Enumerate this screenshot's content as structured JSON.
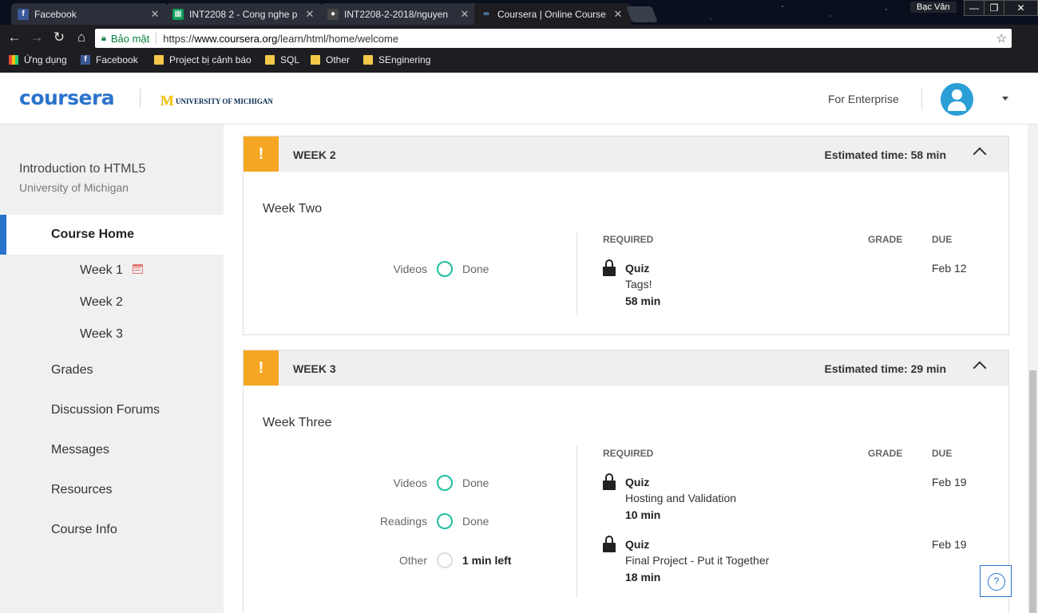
{
  "browser": {
    "tabs": [
      {
        "label": "Facebook",
        "icon": "facebook-icon",
        "color": "#3b5998",
        "glyph": "f"
      },
      {
        "label": "INT2208 2 - Cong nghe p",
        "icon": "sheets-icon",
        "color": "#0f9d58",
        "glyph": "▦"
      },
      {
        "label": "INT2208-2-2018/nguyen",
        "icon": "github-icon",
        "color": "#444444",
        "glyph": "●"
      },
      {
        "label": "Coursera | Online Course",
        "icon": "coursera-icon",
        "color": "#2a73cc",
        "glyph": "∞"
      }
    ],
    "user": "Bạc Vân",
    "secure_label": "Bảo mật",
    "url_scheme": "https://",
    "url_host": "www.coursera.org",
    "url_path": "/learn/html/home/welcome",
    "bookmarks": [
      "Ứng dụng",
      "Facebook",
      "Project bị cảnh báo",
      "SQL",
      "Other",
      "SEnginering"
    ]
  },
  "header": {
    "logo": "coursera",
    "partner": "UNIVERSITY OF MICHIGAN",
    "partner_mark": "M",
    "enterprise": "For Enterprise"
  },
  "sidebar": {
    "course_title": "Introduction to HTML5",
    "course_uni": "University of Michigan",
    "home": "Course Home",
    "weeks": [
      "Week 1",
      "Week 2",
      "Week 3"
    ],
    "items": [
      "Grades",
      "Discussion Forums",
      "Messages",
      "Resources",
      "Course Info"
    ]
  },
  "weeks": [
    {
      "label": "WEEK 2",
      "estimated": "Estimated time: 58 min",
      "name": "Week Two",
      "progress": [
        {
          "label": "Videos",
          "status": "Done"
        }
      ],
      "col_required": "REQUIRED",
      "col_grade": "GRADE",
      "col_due": "DUE",
      "required": [
        {
          "type": "Quiz",
          "name": "Tags!",
          "time": "58 min",
          "due": "Feb 12"
        }
      ]
    },
    {
      "label": "WEEK 3",
      "estimated": "Estimated time: 29 min",
      "name": "Week Three",
      "progress": [
        {
          "label": "Videos",
          "status": "Done"
        },
        {
          "label": "Readings",
          "status": "Done"
        },
        {
          "label": "Other",
          "status": "1 min left"
        }
      ],
      "col_required": "REQUIRED",
      "col_grade": "GRADE",
      "col_due": "DUE",
      "required": [
        {
          "type": "Quiz",
          "name": "Hosting and Validation",
          "time": "10 min",
          "due": "Feb 19"
        },
        {
          "type": "Quiz",
          "name": "Final Project - Put it Together",
          "time": "18 min",
          "due": "Feb 19"
        }
      ]
    }
  ],
  "warn_glyph": "!",
  "help_glyph": "?",
  "colors": {
    "accent": "#2a73cc",
    "warning": "#f5a623",
    "done": "#1fbf9f"
  }
}
